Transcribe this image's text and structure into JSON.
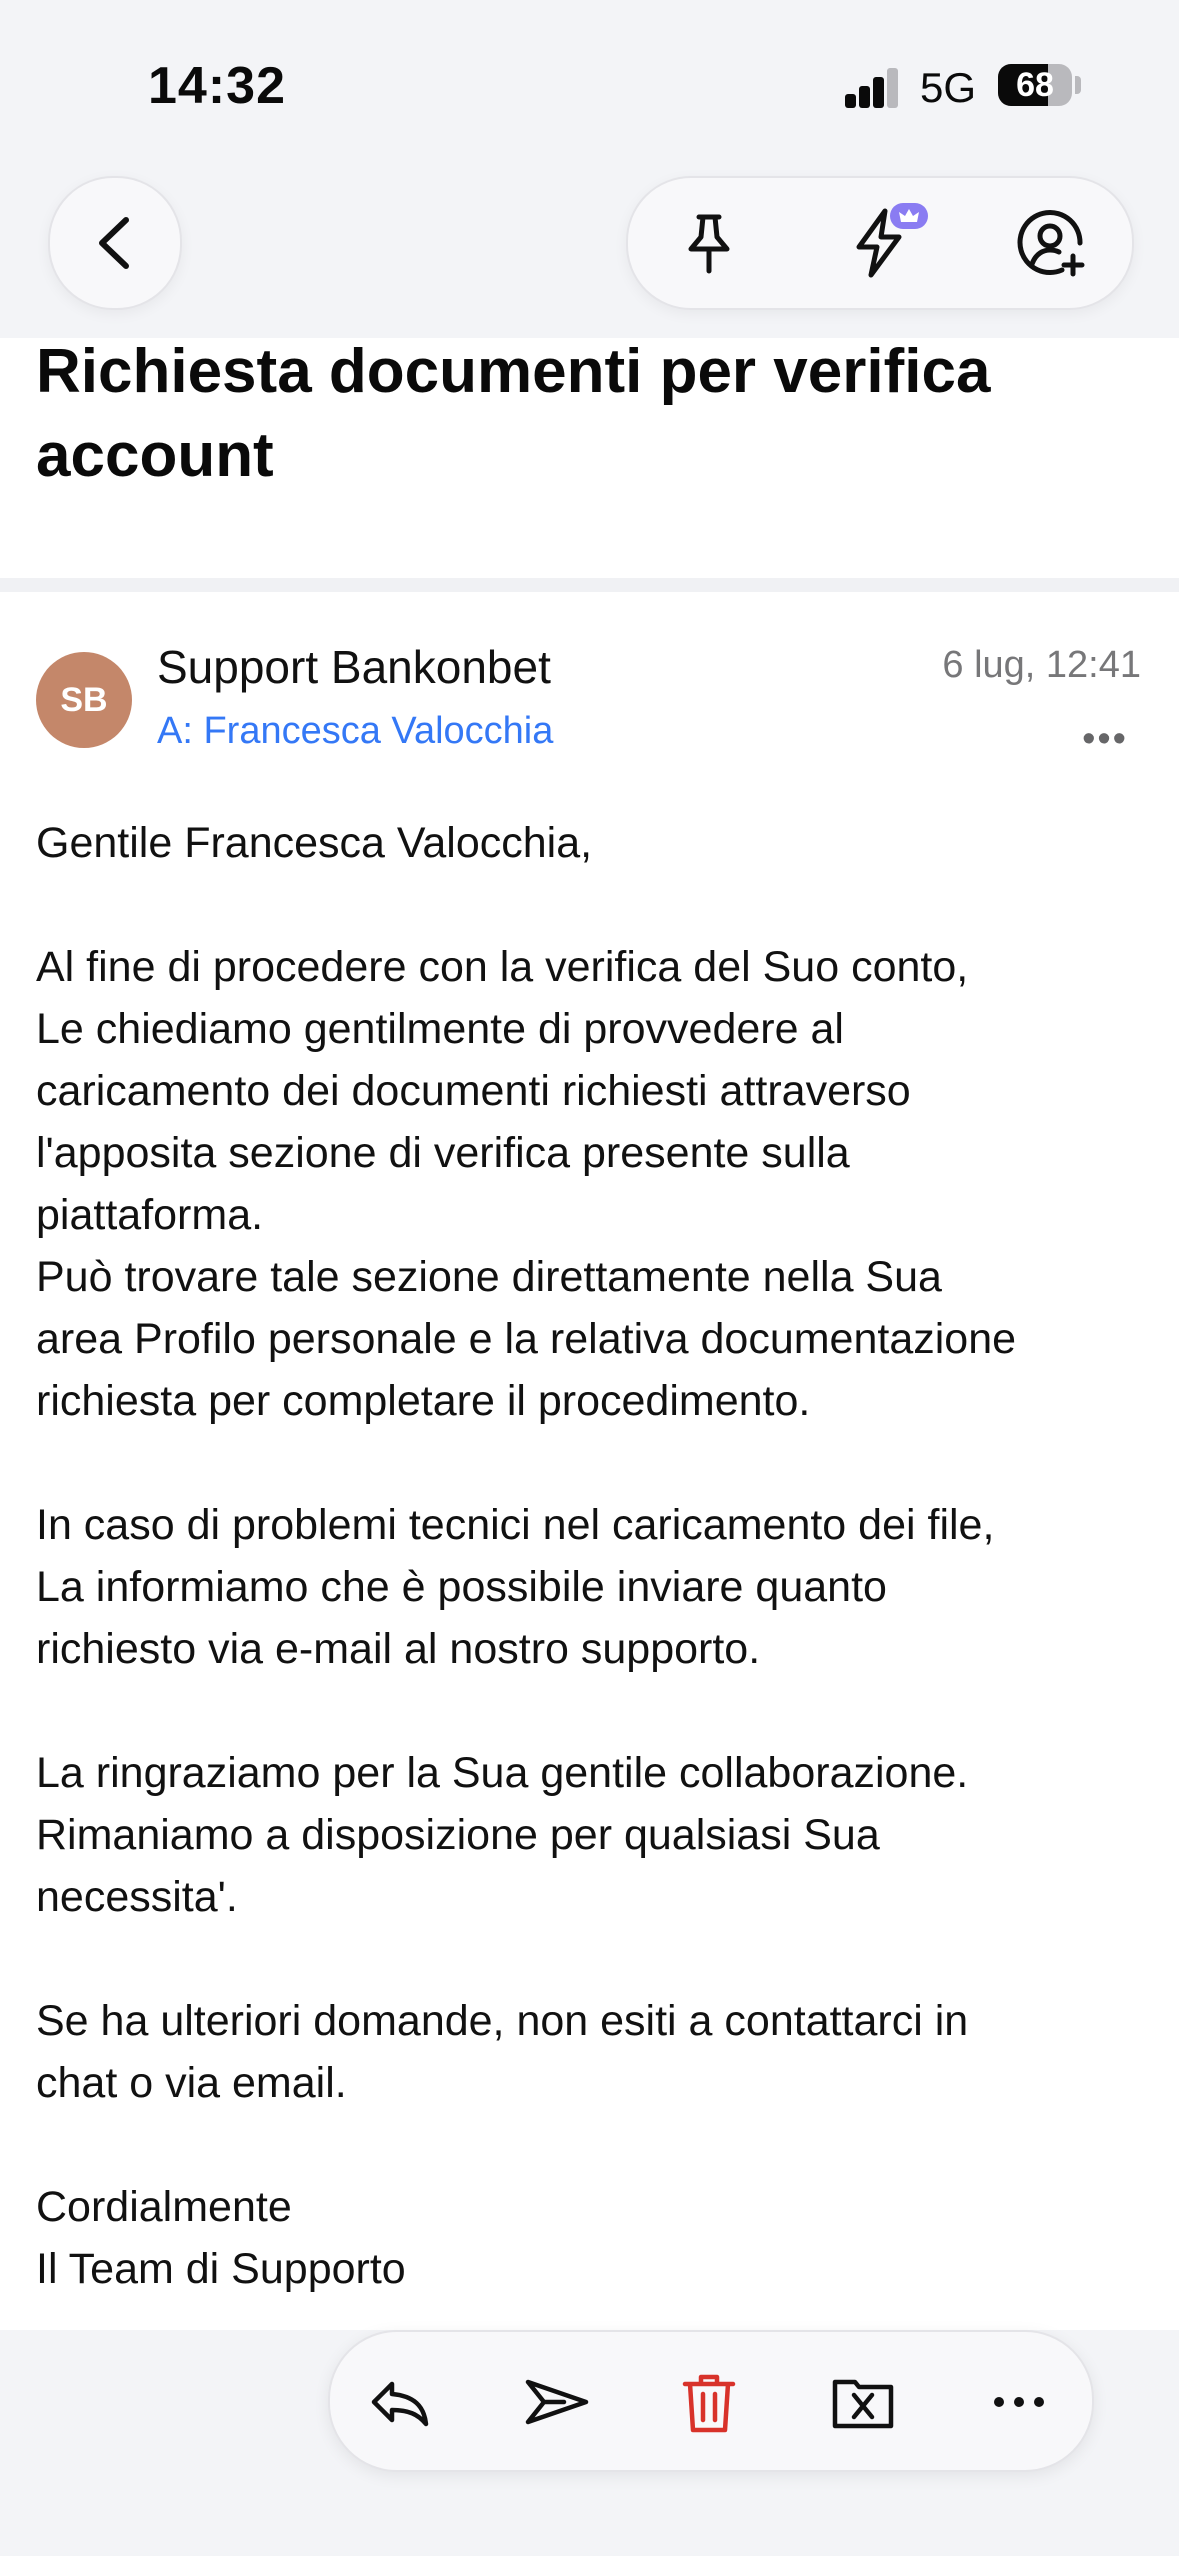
{
  "status_bar": {
    "time": "14:32",
    "network": "5G",
    "battery": "68"
  },
  "nav": {
    "back": "chevron-left-icon",
    "pin": "pin-icon",
    "summarize": "lightning-icon",
    "badge": "crown-icon",
    "add_contact": "person-add-icon"
  },
  "email": {
    "subject": "Richiesta documenti per verifica account",
    "avatar_initials": "SB",
    "avatar_color": "#c4876a",
    "sender": "Support Bankonbet",
    "recipient": "A: Francesca Valocchia",
    "date": "6 lug, 12:41",
    "more": "•••",
    "body": [
      "Gentile Francesca Valocchia,",
      "Al fine di procedere con la verifica del Suo conto,\nLe chiediamo gentilmente di provvedere al\ncaricamento dei documenti richiesti attraverso\nl'apposita sezione di verifica presente sulla\npiattaforma.\nPuò trovare tale sezione direttamente nella Sua\narea Profilo personale e la relativa documentazione\nrichiesta per completare il procedimento.",
      "In caso di problemi tecnici nel caricamento dei file,\nLa informiamo che è possibile inviare quanto\nrichiesto via e-mail al nostro supporto.",
      "La ringraziamo per la Sua gentile collaborazione.\nRimaniamo a disposizione per qualsiasi Sua\nnecessita'.",
      "Se ha ulteriori domande, non esiti a contattarci in\nchat o via email.",
      "Cordialmente\nIl Team di Supporto"
    ]
  },
  "actions": {
    "reply": "reply-icon",
    "forward": "forward-icon",
    "delete": "trash-icon",
    "delete_color": "#d8322a",
    "archive": "folder-x-icon",
    "more": "more-icon"
  },
  "colors": {
    "link": "#3478f6",
    "accent_badge": "#8a7cf2"
  }
}
